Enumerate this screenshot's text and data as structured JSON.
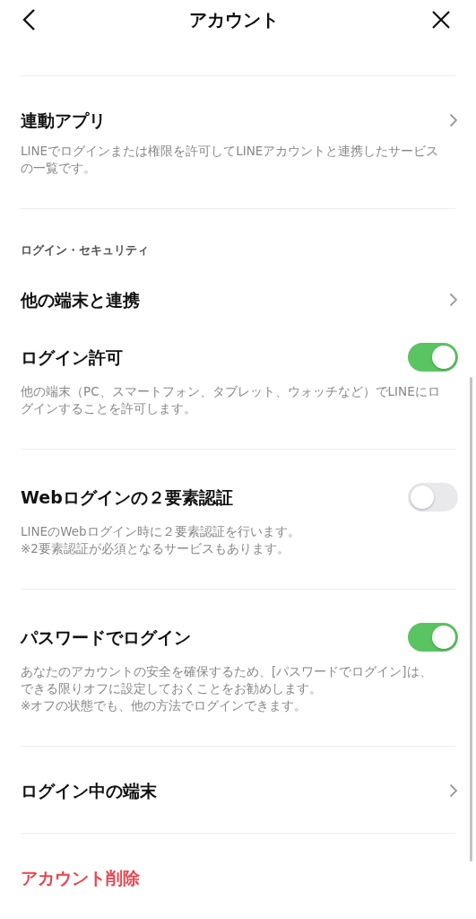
{
  "header": {
    "title": "アカウント"
  },
  "groups": [
    {
      "items": [
        {
          "kind": "link",
          "title": "連動アプリ",
          "description": [
            "LINEでログインまたは権限を許可してLINEアカウントと連携したサービスの一覧です。"
          ]
        }
      ]
    },
    {
      "header": "ログイン・セキュリティ",
      "items": [
        {
          "kind": "link",
          "title": "他の端末と連携"
        },
        {
          "kind": "toggle",
          "title": "ログイン許可",
          "on": true,
          "description": [
            "他の端末（PC、スマートフォン、タブレット、ウォッチなど）でLINEにログインすることを許可します。"
          ]
        }
      ]
    },
    {
      "items": [
        {
          "kind": "toggle",
          "title": "Webログインの２要素認証",
          "on": false,
          "description": [
            "LINEのWebログイン時に２要素認証を行います。",
            "※2要素認証が必須となるサービスもあります。"
          ]
        }
      ]
    },
    {
      "items": [
        {
          "kind": "toggle",
          "title": "パスワードでログイン",
          "on": true,
          "description": [
            "あなたのアカウントの安全を確保するため、[パスワードでログイン]は、できる限りオフに設定しておくことをお勧めします。",
            "※オフの状態でも、他の方法でログインできます。"
          ]
        }
      ]
    },
    {
      "items": [
        {
          "kind": "link",
          "title": "ログイン中の端末"
        }
      ]
    },
    {
      "items": [
        {
          "kind": "danger",
          "title": "アカウント削除"
        }
      ]
    }
  ]
}
